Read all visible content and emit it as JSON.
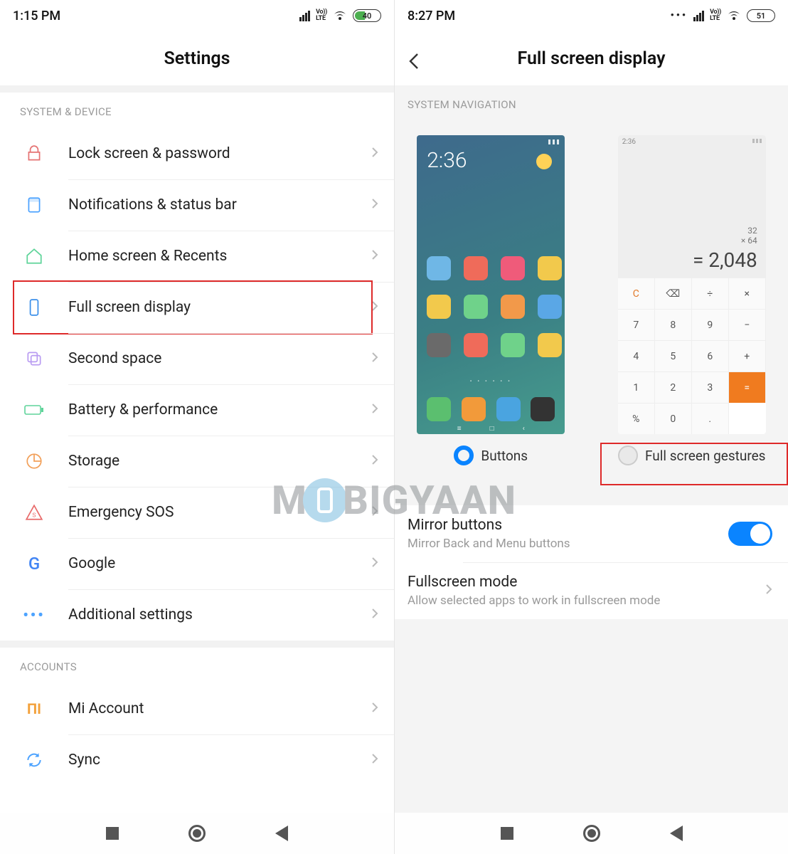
{
  "watermark": "MOBIGYAAN",
  "left": {
    "status": {
      "time": "1:15 PM",
      "volte": "Vo))\nLTE",
      "battery": "40"
    },
    "title": "Settings",
    "sections": {
      "system_device": {
        "header": "SYSTEM & DEVICE",
        "items": [
          {
            "id": "lock-screen",
            "label": "Lock screen & password",
            "icon": "lock-icon",
            "color": "#e57373"
          },
          {
            "id": "notifications",
            "label": "Notifications & status bar",
            "icon": "notification-icon",
            "color": "#4da3ff"
          },
          {
            "id": "home-recents",
            "label": "Home screen & Recents",
            "icon": "home-icon",
            "color": "#5fd49a"
          },
          {
            "id": "full-screen",
            "label": "Full screen display",
            "icon": "fullscreen-icon",
            "color": "#3a8fea",
            "highlighted": true
          },
          {
            "id": "second-space",
            "label": "Second space",
            "icon": "second-space-icon",
            "color": "#b99cf2"
          },
          {
            "id": "battery",
            "label": "Battery & performance",
            "icon": "battery-icon",
            "color": "#5fd49a"
          },
          {
            "id": "storage",
            "label": "Storage",
            "icon": "storage-icon",
            "color": "#f2a05a"
          },
          {
            "id": "emergency",
            "label": "Emergency SOS",
            "icon": "sos-icon",
            "color": "#e86a6a"
          },
          {
            "id": "google",
            "label": "Google",
            "icon": "google-icon",
            "color": "#4285f4"
          },
          {
            "id": "additional",
            "label": "Additional settings",
            "icon": "more-icon",
            "color": "#4da3ff"
          }
        ]
      },
      "accounts": {
        "header": "ACCOUNTS",
        "items": [
          {
            "id": "mi-account",
            "label": "Mi Account",
            "icon": "mi-icon",
            "color": "#f3a13b"
          },
          {
            "id": "sync",
            "label": "Sync",
            "icon": "sync-icon",
            "color": "#4da3ff"
          }
        ]
      }
    }
  },
  "right": {
    "status": {
      "time": "8:27 PM",
      "volte": "Vo))\nLTE",
      "battery": "51"
    },
    "title": "Full screen display",
    "section_header": "SYSTEM NAVIGATION",
    "choices": {
      "buttons": {
        "label": "Buttons",
        "selected": true
      },
      "gestures": {
        "label": "Full screen gestures",
        "selected": false,
        "highlighted": true
      }
    },
    "home_preview": {
      "time": "2:36",
      "app_colors": [
        "#6fb7e6",
        "#ef6b5a",
        "#ef5b7a",
        "#f2c94c",
        "#f2c94c",
        "#6fd28a",
        "#f2994a",
        "#5aa7e6",
        "#6a6a6a",
        "#ef6b5a",
        "#6fd28a",
        "#f2c94c"
      ],
      "dock_colors": [
        "#5bbf6f",
        "#f29a3a",
        "#4aa4e0",
        "#333333"
      ]
    },
    "calc_preview": {
      "time": "2:36",
      "history": [
        "32",
        "× 64"
      ],
      "result": "= 2,048",
      "keys": [
        [
          "C",
          "⌫",
          "÷",
          "×",
          "−"
        ],
        [
          "7",
          "8",
          "9",
          "−",
          ""
        ],
        [
          "4",
          "5",
          "6",
          "+",
          ""
        ],
        [
          "1",
          "2",
          "3",
          "=",
          ""
        ],
        [
          "%",
          "0",
          ".",
          "",
          ""
        ]
      ],
      "grid": {
        "r1": [
          "C",
          "⌫",
          "÷",
          "×"
        ],
        "r2": [
          "7",
          "8",
          "9",
          "−"
        ],
        "r3": [
          "4",
          "5",
          "6",
          "+"
        ],
        "r4": [
          "1",
          "2",
          "3",
          "="
        ],
        "r5": [
          "%",
          "0",
          ".",
          "="
        ]
      }
    },
    "rows": [
      {
        "id": "mirror-buttons",
        "title": "Mirror buttons",
        "sub": "Mirror Back and Menu buttons",
        "type": "switch",
        "value": true
      },
      {
        "id": "fullscreen-mode",
        "title": "Fullscreen mode",
        "sub": "Allow selected apps to work in fullscreen mode",
        "type": "link"
      }
    ]
  }
}
